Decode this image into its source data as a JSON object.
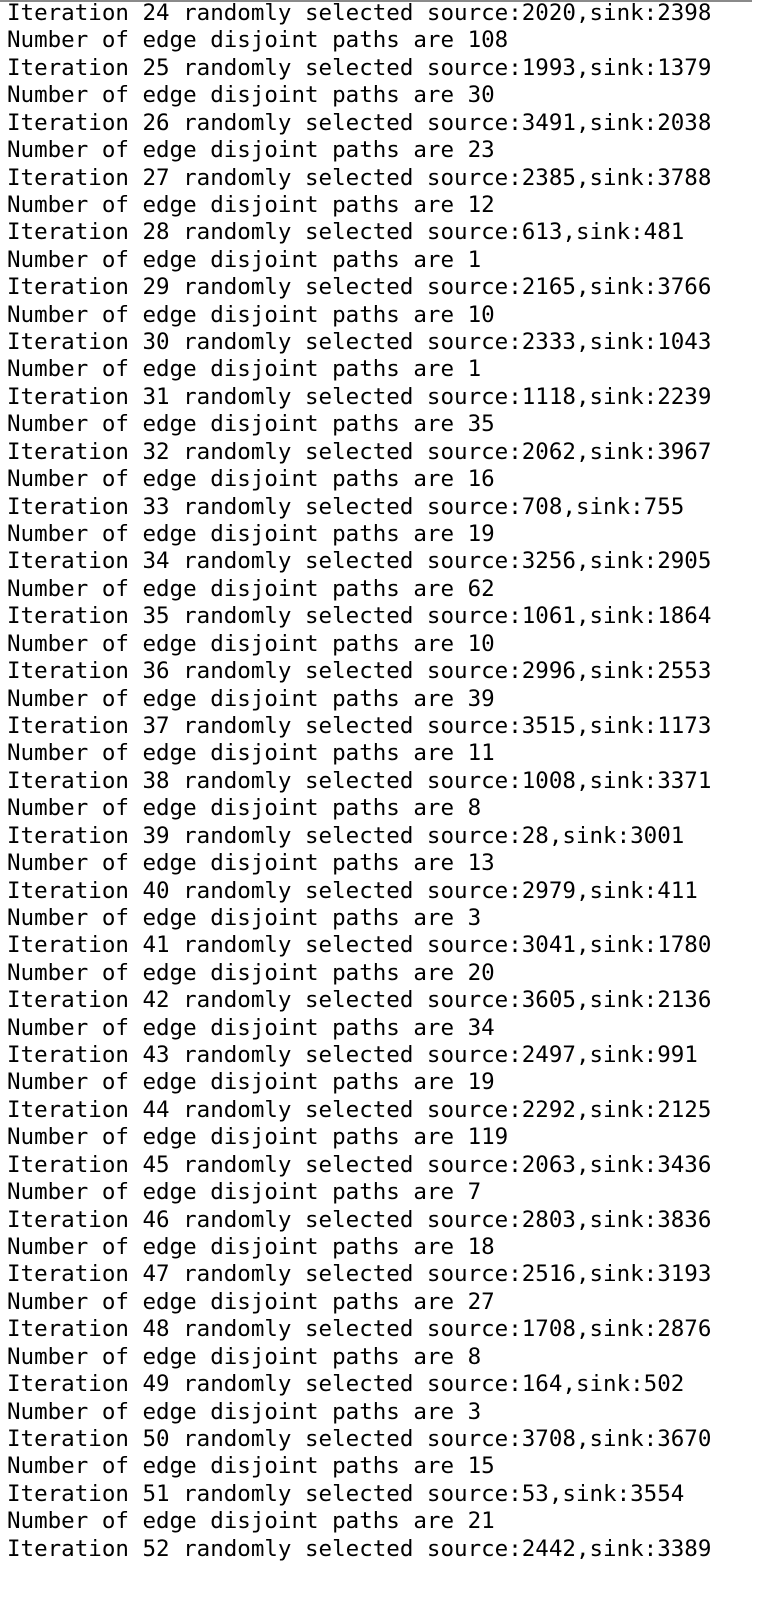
{
  "terminal": {
    "lines": [
      "Iteration 24 randomly selected source:2020,sink:2398",
      "Number of edge disjoint paths are 108",
      "Iteration 25 randomly selected source:1993,sink:1379",
      "Number of edge disjoint paths are 30",
      "Iteration 26 randomly selected source:3491,sink:2038",
      "Number of edge disjoint paths are 23",
      "Iteration 27 randomly selected source:2385,sink:3788",
      "Number of edge disjoint paths are 12",
      "Iteration 28 randomly selected source:613,sink:481",
      "Number of edge disjoint paths are 1",
      "Iteration 29 randomly selected source:2165,sink:3766",
      "Number of edge disjoint paths are 10",
      "Iteration 30 randomly selected source:2333,sink:1043",
      "Number of edge disjoint paths are 1",
      "Iteration 31 randomly selected source:1118,sink:2239",
      "Number of edge disjoint paths are 35",
      "Iteration 32 randomly selected source:2062,sink:3967",
      "Number of edge disjoint paths are 16",
      "Iteration 33 randomly selected source:708,sink:755",
      "Number of edge disjoint paths are 19",
      "Iteration 34 randomly selected source:3256,sink:2905",
      "Number of edge disjoint paths are 62",
      "Iteration 35 randomly selected source:1061,sink:1864",
      "Number of edge disjoint paths are 10",
      "Iteration 36 randomly selected source:2996,sink:2553",
      "Number of edge disjoint paths are 39",
      "Iteration 37 randomly selected source:3515,sink:1173",
      "Number of edge disjoint paths are 11",
      "Iteration 38 randomly selected source:1008,sink:3371",
      "Number of edge disjoint paths are 8",
      "Iteration 39 randomly selected source:28,sink:3001",
      "Number of edge disjoint paths are 13",
      "Iteration 40 randomly selected source:2979,sink:411",
      "Number of edge disjoint paths are 3",
      "Iteration 41 randomly selected source:3041,sink:1780",
      "Number of edge disjoint paths are 20",
      "Iteration 42 randomly selected source:3605,sink:2136",
      "Number of edge disjoint paths are 34",
      "Iteration 43 randomly selected source:2497,sink:991",
      "Number of edge disjoint paths are 19",
      "Iteration 44 randomly selected source:2292,sink:2125",
      "Number of edge disjoint paths are 119",
      "Iteration 45 randomly selected source:2063,sink:3436",
      "Number of edge disjoint paths are 7",
      "Iteration 46 randomly selected source:2803,sink:3836",
      "Number of edge disjoint paths are 18",
      "Iteration 47 randomly selected source:2516,sink:3193",
      "Number of edge disjoint paths are 27",
      "Iteration 48 randomly selected source:1708,sink:2876",
      "Number of edge disjoint paths are 8",
      "Iteration 49 randomly selected source:164,sink:502",
      "Number of edge disjoint paths are 3",
      "Iteration 50 randomly selected source:3708,sink:3670",
      "Number of edge disjoint paths are 15",
      "Iteration 51 randomly selected source:53,sink:3554",
      "Number of edge disjoint paths are 21",
      "Iteration 52 randomly selected source:2442,sink:3389"
    ]
  }
}
